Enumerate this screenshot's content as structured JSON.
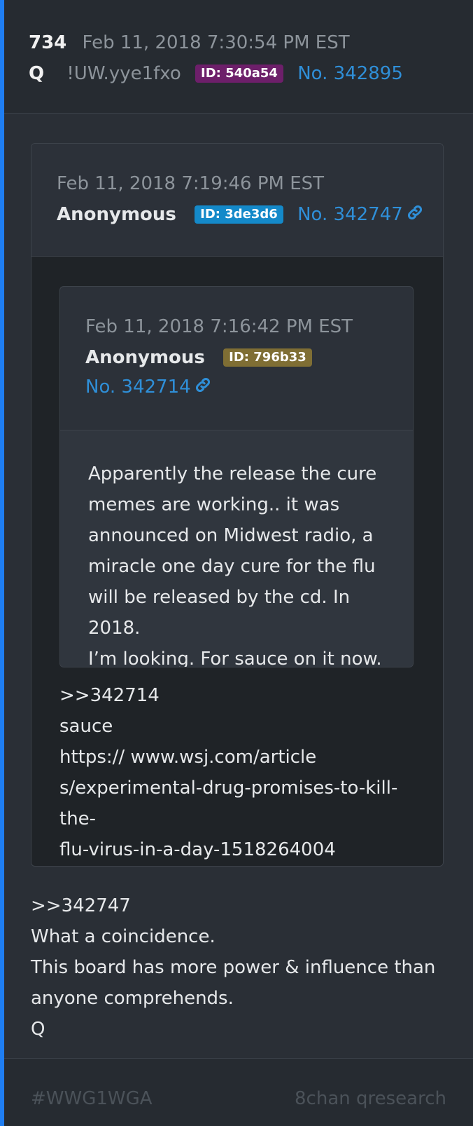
{
  "post": {
    "number": "734",
    "datetime": "Feb 11, 2018 7:30:54 PM EST",
    "author": "Q",
    "tripcode": "!UW.yye1fxo",
    "id_badge": "ID: 540a54",
    "post_id": "No. 342895",
    "body": [
      ">>342747",
      "What a coincidence.",
      "This board has more power & influence than",
      "anyone comprehends.",
      "Q"
    ]
  },
  "quote1": {
    "datetime": "Feb 11, 2018 7:19:46 PM EST",
    "name": "Anonymous",
    "id_badge": "ID: 3de3d6",
    "post_id": "No. 342747",
    "body": [
      ">>342714",
      "sauce",
      "https://  www.wsj.com/article",
      "s/experimental-drug-promises-to-kill-the-",
      "flu-virus-in-a-day-1518264004"
    ]
  },
  "quote2": {
    "datetime": "Feb 11, 2018 7:16:42 PM EST",
    "name": "Anonymous",
    "id_badge": "ID: 796b33",
    "post_id": "No. 342714",
    "body": [
      "Apparently the release the cure",
      "memes are working.. it was",
      "announced on Midwest radio, a",
      "miracle one day cure for the flu",
      "will be released by the cd. In 2018.",
      "I’m looking. For sauce on it now."
    ]
  },
  "footer": {
    "hashtag": "#WWG1WGA",
    "source": "8chan qresearch"
  },
  "colors": {
    "accent": "#1f7ef2",
    "link": "#2f8fd8",
    "badge_purple": "#6d1f6a",
    "badge_blue": "#1489c9",
    "badge_olive": "#7f6e34"
  },
  "icons": [
    "link-icon"
  ]
}
